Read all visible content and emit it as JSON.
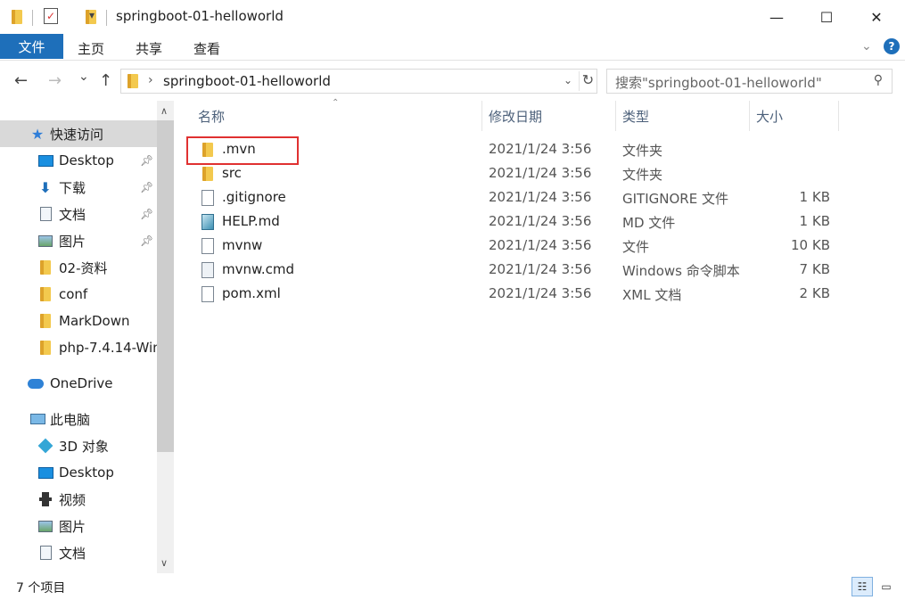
{
  "window": {
    "title": "springboot-01-helloworld",
    "minimize": "—",
    "maximize": "☐",
    "close": "✕"
  },
  "ribbon": {
    "tabs": [
      "文件",
      "主页",
      "共享",
      "查看"
    ]
  },
  "nav": {
    "back": "←",
    "forward": "→",
    "recent": "⌄",
    "up": "↑"
  },
  "address": {
    "separator": "›",
    "path": "springboot-01-helloworld"
  },
  "search": {
    "placeholder": "搜索\"springboot-01-helloworld\""
  },
  "sidebar": {
    "items": [
      {
        "label": "快速访问",
        "icon": "star-icon",
        "selected": true
      },
      {
        "label": "Desktop",
        "icon": "desktop-icon",
        "pinned": true
      },
      {
        "label": "下载",
        "icon": "download-icon",
        "pinned": true
      },
      {
        "label": "文档",
        "icon": "document-icon",
        "pinned": true
      },
      {
        "label": "图片",
        "icon": "picture-icon",
        "pinned": true
      },
      {
        "label": "02-资料",
        "icon": "folder-icon"
      },
      {
        "label": "conf",
        "icon": "folder-icon"
      },
      {
        "label": "MarkDown",
        "icon": "folder-icon"
      },
      {
        "label": "php-7.4.14-Win",
        "icon": "folder-icon"
      },
      {
        "label": "OneDrive",
        "icon": "cloud-icon"
      },
      {
        "label": "此电脑",
        "icon": "computer-icon"
      },
      {
        "label": "3D 对象",
        "icon": "3d-objects-icon"
      },
      {
        "label": "Desktop",
        "icon": "desktop-icon"
      },
      {
        "label": "视频",
        "icon": "video-icon"
      },
      {
        "label": "图片",
        "icon": "picture-icon"
      },
      {
        "label": "文档",
        "icon": "document-icon"
      }
    ]
  },
  "columns": {
    "name": "名称",
    "modified": "修改日期",
    "type": "类型",
    "size": "大小"
  },
  "files": [
    {
      "name": ".mvn",
      "modified": "2021/1/24 3:56",
      "type": "文件夹",
      "size": "",
      "icon": "folder-icon"
    },
    {
      "name": "src",
      "modified": "2021/1/24 3:56",
      "type": "文件夹",
      "size": "",
      "icon": "folder-icon"
    },
    {
      "name": ".gitignore",
      "modified": "2021/1/24 3:56",
      "type": "GITIGNORE 文件",
      "size": "1 KB",
      "icon": "file-icon"
    },
    {
      "name": "HELP.md",
      "modified": "2021/1/24 3:56",
      "type": "MD 文件",
      "size": "1 KB",
      "icon": "markdown-file-icon"
    },
    {
      "name": "mvnw",
      "modified": "2021/1/24 3:56",
      "type": "文件",
      "size": "10 KB",
      "icon": "file-icon"
    },
    {
      "name": "mvnw.cmd",
      "modified": "2021/1/24 3:56",
      "type": "Windows 命令脚本",
      "size": "7 KB",
      "icon": "cmd-file-icon"
    },
    {
      "name": "pom.xml",
      "modified": "2021/1/24 3:56",
      "type": "XML 文档",
      "size": "2 KB",
      "icon": "file-icon"
    }
  ],
  "status": {
    "item_count": "7 个项目"
  },
  "colors": {
    "file_tab": "#1e6fba",
    "highlight_box": "#e03131",
    "selected_nav": "#d9d9d9",
    "header_text": "#4c607a"
  }
}
